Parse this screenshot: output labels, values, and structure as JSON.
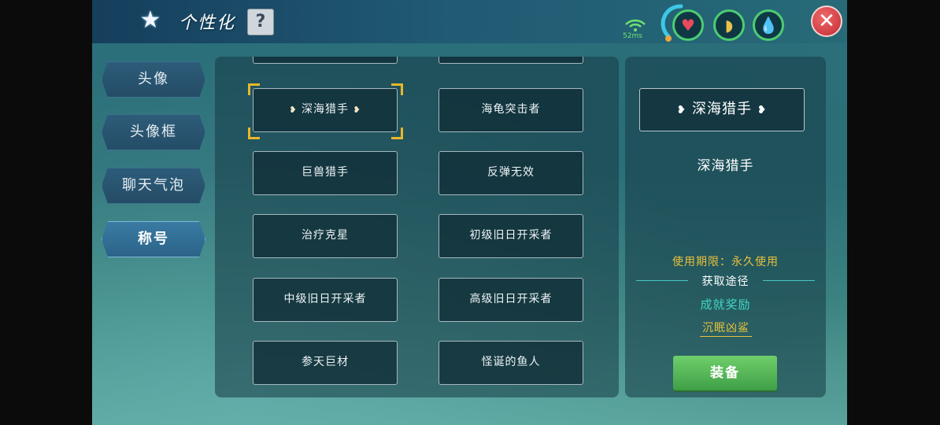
{
  "header": {
    "title": "个性化",
    "help_label": "?",
    "ping": "52ms",
    "close_label": "✕"
  },
  "status": {
    "heart_glyph": "♥",
    "food_glyph": "◗",
    "water_glyph": "💧"
  },
  "tabs": [
    {
      "label": "头像",
      "active": false
    },
    {
      "label": "头像框",
      "active": false
    },
    {
      "label": "聊天气泡",
      "active": false
    },
    {
      "label": "称号",
      "active": true
    }
  ],
  "titles": [
    {
      "label": "深海猎手",
      "selected": true,
      "winged": true
    },
    {
      "label": "海龟突击者",
      "selected": false,
      "winged": false
    },
    {
      "label": "巨兽猎手",
      "selected": false,
      "winged": false
    },
    {
      "label": "反弹无效",
      "selected": false,
      "winged": false
    },
    {
      "label": "治疗克星",
      "selected": false,
      "winged": false
    },
    {
      "label": "初级旧日开采者",
      "selected": false,
      "winged": false
    },
    {
      "label": "中级旧日开采者",
      "selected": false,
      "winged": false
    },
    {
      "label": "高级旧日开采者",
      "selected": false,
      "winged": false
    },
    {
      "label": "参天巨材",
      "selected": false,
      "winged": false
    },
    {
      "label": "怪诞的鱼人",
      "selected": false,
      "winged": false
    }
  ],
  "detail": {
    "preview": "深海猎手",
    "name": "深海猎手",
    "validity": "使用期限：永久使用",
    "source_label": "获取途径",
    "source_type": "成就奖励",
    "source_link": "沉眠凶鲨",
    "equip_label": "装备"
  },
  "colors": {
    "accent_gold": "#e8c03a",
    "accent_teal": "#41d6c6",
    "equip_green": "#4fb651",
    "close_red": "#d23a42"
  }
}
